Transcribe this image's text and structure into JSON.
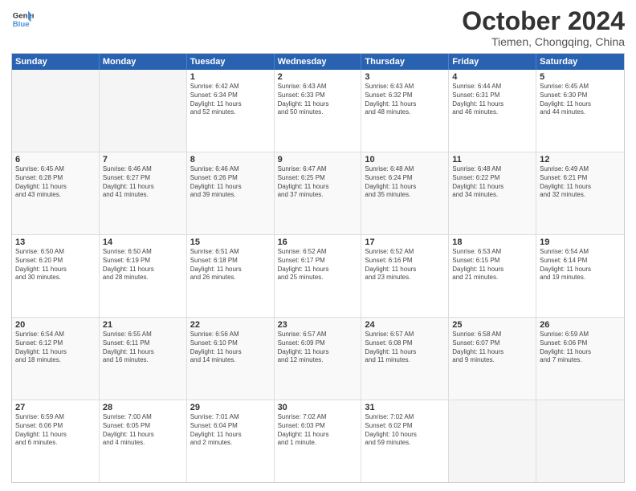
{
  "header": {
    "logo_line1": "General",
    "logo_line2": "Blue",
    "month": "October 2024",
    "location": "Tiemen, Chongqing, China"
  },
  "days_of_week": [
    "Sunday",
    "Monday",
    "Tuesday",
    "Wednesday",
    "Thursday",
    "Friday",
    "Saturday"
  ],
  "weeks": [
    [
      {
        "day": "",
        "empty": true
      },
      {
        "day": "",
        "empty": true
      },
      {
        "day": "1",
        "line1": "Sunrise: 6:42 AM",
        "line2": "Sunset: 6:34 PM",
        "line3": "Daylight: 11 hours",
        "line4": "and 52 minutes."
      },
      {
        "day": "2",
        "line1": "Sunrise: 6:43 AM",
        "line2": "Sunset: 6:33 PM",
        "line3": "Daylight: 11 hours",
        "line4": "and 50 minutes."
      },
      {
        "day": "3",
        "line1": "Sunrise: 6:43 AM",
        "line2": "Sunset: 6:32 PM",
        "line3": "Daylight: 11 hours",
        "line4": "and 48 minutes."
      },
      {
        "day": "4",
        "line1": "Sunrise: 6:44 AM",
        "line2": "Sunset: 6:31 PM",
        "line3": "Daylight: 11 hours",
        "line4": "and 46 minutes."
      },
      {
        "day": "5",
        "line1": "Sunrise: 6:45 AM",
        "line2": "Sunset: 6:30 PM",
        "line3": "Daylight: 11 hours",
        "line4": "and 44 minutes."
      }
    ],
    [
      {
        "day": "6",
        "line1": "Sunrise: 6:45 AM",
        "line2": "Sunset: 6:28 PM",
        "line3": "Daylight: 11 hours",
        "line4": "and 43 minutes."
      },
      {
        "day": "7",
        "line1": "Sunrise: 6:46 AM",
        "line2": "Sunset: 6:27 PM",
        "line3": "Daylight: 11 hours",
        "line4": "and 41 minutes."
      },
      {
        "day": "8",
        "line1": "Sunrise: 6:46 AM",
        "line2": "Sunset: 6:26 PM",
        "line3": "Daylight: 11 hours",
        "line4": "and 39 minutes."
      },
      {
        "day": "9",
        "line1": "Sunrise: 6:47 AM",
        "line2": "Sunset: 6:25 PM",
        "line3": "Daylight: 11 hours",
        "line4": "and 37 minutes."
      },
      {
        "day": "10",
        "line1": "Sunrise: 6:48 AM",
        "line2": "Sunset: 6:24 PM",
        "line3": "Daylight: 11 hours",
        "line4": "and 35 minutes."
      },
      {
        "day": "11",
        "line1": "Sunrise: 6:48 AM",
        "line2": "Sunset: 6:22 PM",
        "line3": "Daylight: 11 hours",
        "line4": "and 34 minutes."
      },
      {
        "day": "12",
        "line1": "Sunrise: 6:49 AM",
        "line2": "Sunset: 6:21 PM",
        "line3": "Daylight: 11 hours",
        "line4": "and 32 minutes."
      }
    ],
    [
      {
        "day": "13",
        "line1": "Sunrise: 6:50 AM",
        "line2": "Sunset: 6:20 PM",
        "line3": "Daylight: 11 hours",
        "line4": "and 30 minutes."
      },
      {
        "day": "14",
        "line1": "Sunrise: 6:50 AM",
        "line2": "Sunset: 6:19 PM",
        "line3": "Daylight: 11 hours",
        "line4": "and 28 minutes."
      },
      {
        "day": "15",
        "line1": "Sunrise: 6:51 AM",
        "line2": "Sunset: 6:18 PM",
        "line3": "Daylight: 11 hours",
        "line4": "and 26 minutes."
      },
      {
        "day": "16",
        "line1": "Sunrise: 6:52 AM",
        "line2": "Sunset: 6:17 PM",
        "line3": "Daylight: 11 hours",
        "line4": "and 25 minutes."
      },
      {
        "day": "17",
        "line1": "Sunrise: 6:52 AM",
        "line2": "Sunset: 6:16 PM",
        "line3": "Daylight: 11 hours",
        "line4": "and 23 minutes."
      },
      {
        "day": "18",
        "line1": "Sunrise: 6:53 AM",
        "line2": "Sunset: 6:15 PM",
        "line3": "Daylight: 11 hours",
        "line4": "and 21 minutes."
      },
      {
        "day": "19",
        "line1": "Sunrise: 6:54 AM",
        "line2": "Sunset: 6:14 PM",
        "line3": "Daylight: 11 hours",
        "line4": "and 19 minutes."
      }
    ],
    [
      {
        "day": "20",
        "line1": "Sunrise: 6:54 AM",
        "line2": "Sunset: 6:12 PM",
        "line3": "Daylight: 11 hours",
        "line4": "and 18 minutes."
      },
      {
        "day": "21",
        "line1": "Sunrise: 6:55 AM",
        "line2": "Sunset: 6:11 PM",
        "line3": "Daylight: 11 hours",
        "line4": "and 16 minutes."
      },
      {
        "day": "22",
        "line1": "Sunrise: 6:56 AM",
        "line2": "Sunset: 6:10 PM",
        "line3": "Daylight: 11 hours",
        "line4": "and 14 minutes."
      },
      {
        "day": "23",
        "line1": "Sunrise: 6:57 AM",
        "line2": "Sunset: 6:09 PM",
        "line3": "Daylight: 11 hours",
        "line4": "and 12 minutes."
      },
      {
        "day": "24",
        "line1": "Sunrise: 6:57 AM",
        "line2": "Sunset: 6:08 PM",
        "line3": "Daylight: 11 hours",
        "line4": "and 11 minutes."
      },
      {
        "day": "25",
        "line1": "Sunrise: 6:58 AM",
        "line2": "Sunset: 6:07 PM",
        "line3": "Daylight: 11 hours",
        "line4": "and 9 minutes."
      },
      {
        "day": "26",
        "line1": "Sunrise: 6:59 AM",
        "line2": "Sunset: 6:06 PM",
        "line3": "Daylight: 11 hours",
        "line4": "and 7 minutes."
      }
    ],
    [
      {
        "day": "27",
        "line1": "Sunrise: 6:59 AM",
        "line2": "Sunset: 6:06 PM",
        "line3": "Daylight: 11 hours",
        "line4": "and 6 minutes."
      },
      {
        "day": "28",
        "line1": "Sunrise: 7:00 AM",
        "line2": "Sunset: 6:05 PM",
        "line3": "Daylight: 11 hours",
        "line4": "and 4 minutes."
      },
      {
        "day": "29",
        "line1": "Sunrise: 7:01 AM",
        "line2": "Sunset: 6:04 PM",
        "line3": "Daylight: 11 hours",
        "line4": "and 2 minutes."
      },
      {
        "day": "30",
        "line1": "Sunrise: 7:02 AM",
        "line2": "Sunset: 6:03 PM",
        "line3": "Daylight: 11 hours",
        "line4": "and 1 minute."
      },
      {
        "day": "31",
        "line1": "Sunrise: 7:02 AM",
        "line2": "Sunset: 6:02 PM",
        "line3": "Daylight: 10 hours",
        "line4": "and 59 minutes."
      },
      {
        "day": "",
        "empty": true
      },
      {
        "day": "",
        "empty": true
      }
    ]
  ]
}
